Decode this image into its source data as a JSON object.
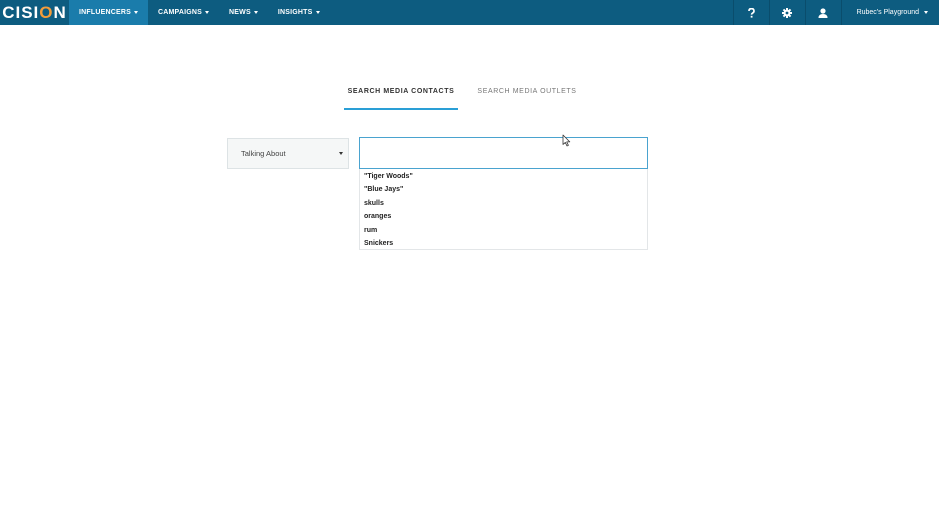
{
  "brand": {
    "logo_prefix": "CISI",
    "logo_o": "O",
    "logo_suffix": "N"
  },
  "nav": {
    "items": [
      {
        "label": "INFLUENCERS",
        "active": true
      },
      {
        "label": "CAMPAIGNS",
        "active": false
      },
      {
        "label": "NEWS",
        "active": false
      },
      {
        "label": "INSIGHTS",
        "active": false
      }
    ],
    "help_icon": "question-icon",
    "settings_icon": "gear-icon",
    "user_icon": "user-icon",
    "account_label": "Rubec's Playground"
  },
  "tabs": [
    {
      "label": "SEARCH MEDIA CONTACTS",
      "active": true
    },
    {
      "label": "SEARCH MEDIA OUTLETS",
      "active": false
    }
  ],
  "search": {
    "type_selected": "Talking About",
    "input_value": "",
    "suggestions": [
      "\"Tiger Woods\"",
      "\"Blue Jays\"",
      "skulls",
      "oranges",
      "rum",
      "Snickers"
    ]
  },
  "colors": {
    "nav_bg": "#0d5c80",
    "nav_active": "#1a7cab",
    "accent": "#2a9fd6",
    "logo_o": "#f39c3a"
  }
}
